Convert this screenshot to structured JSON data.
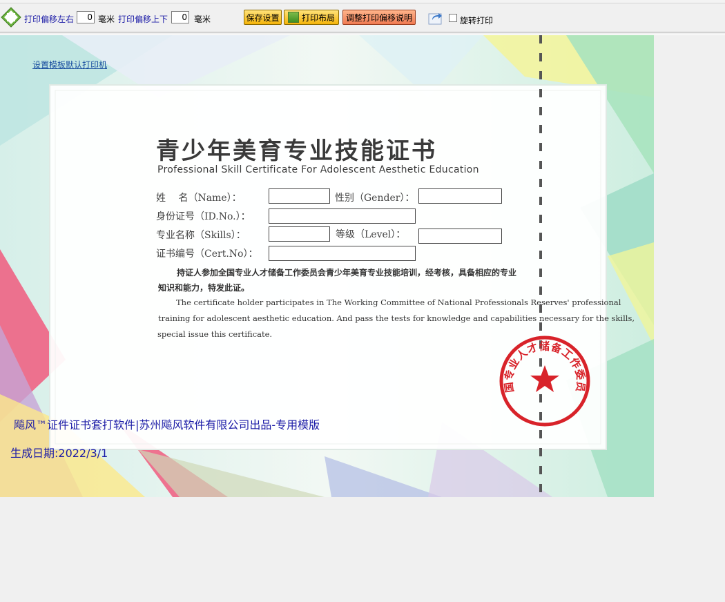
{
  "toolbar": {
    "offset_lr_label": "打印偏移左右",
    "offset_lr_value": "0",
    "offset_ud_label": "打印偏移上下",
    "offset_ud_value": "0",
    "unit_mm": "毫米",
    "save_label": "保存设置",
    "layout_label": "打印布局",
    "help_label": "调整打印偏移说明",
    "rotate_label": "旋转打印",
    "icons": {
      "nav": "arrow-pad-icon",
      "share": "share-arrow-icon",
      "layout": "grid-icon"
    }
  },
  "certificate": {
    "printer_link": "设置模板默认打印机",
    "title_cn": "青少年美育专业技能证书",
    "title_en": "Professional Skill Certificate For Adolescent Aesthetic Education",
    "fields": {
      "name": "姓　 名（Name）：",
      "gender": "性别（Gender）：",
      "id_no": "身份证号（ID.No.）：",
      "skills": "专业名称（Skills）：",
      "level": "等级（Level）：",
      "cert_no": "证书编号（Cert.No）："
    },
    "para_cn_1": "持证人参加全国专业人才储备工作委员会青少年美育专业技能培训，经考核，具备相应的专业",
    "para_cn_2": "知识和能力，特发此证。",
    "para_en_1": "The certificate holder participates in The Working Committee of National Professionals Reserves' professional",
    "para_en_2": "training for adolescent aesthetic education. And pass the tests for knowledge and capabilities necessary for the skills,",
    "para_en_3": "special issue this certificate.",
    "seal_text": "全国专业人才储备工作委员会",
    "footer_company": "飚风™证件证书套打软件|苏州飚风软件有限公司出品-专用模版",
    "footer_date": "生成日期:2022/3/1"
  },
  "colors": {
    "accent_blue": "#1a1aa6",
    "seal_red": "#d8232a",
    "button_yellow": "#f5b40a",
    "button_orange": "#f07a52"
  }
}
